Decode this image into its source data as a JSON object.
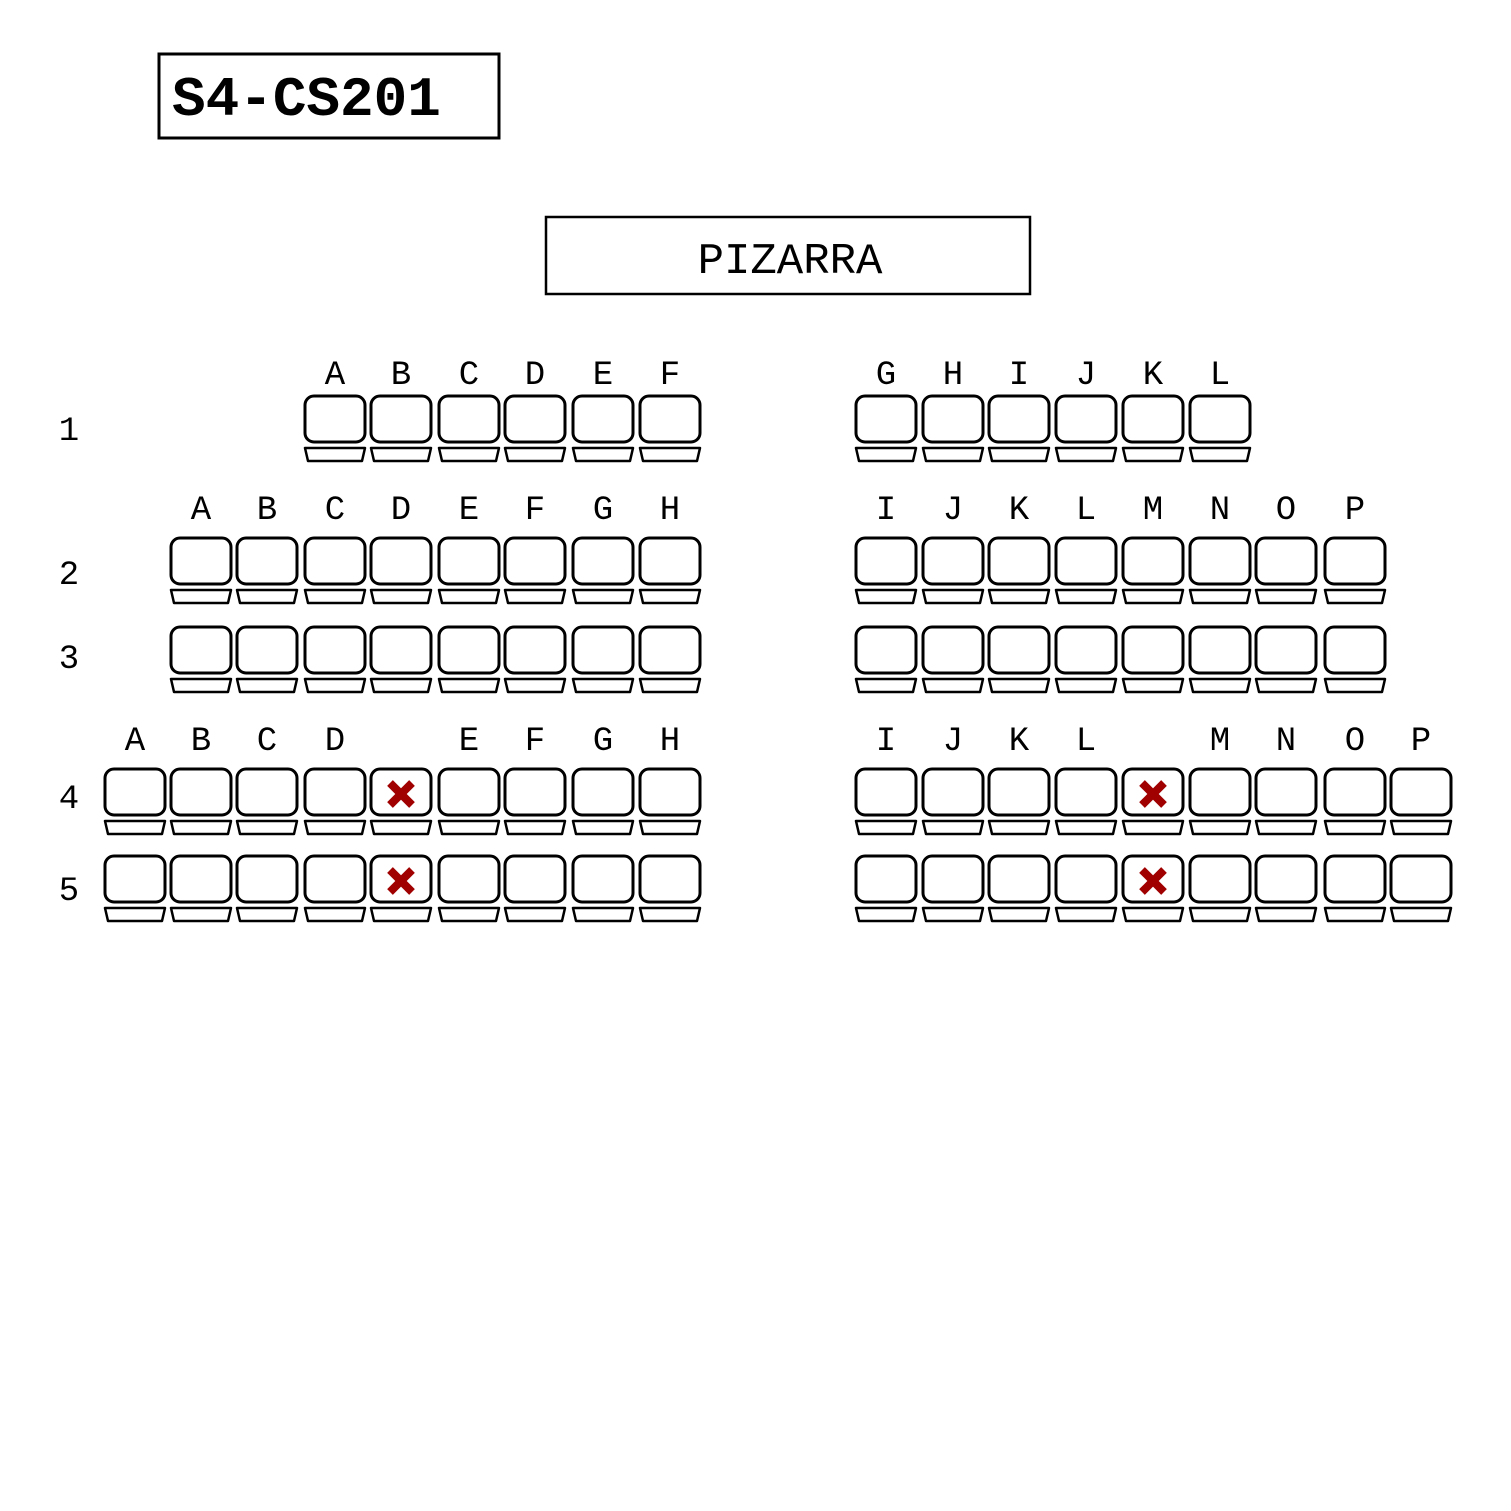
{
  "room_code": "S4-CS201",
  "board_label": "PIZARRA",
  "colors": {
    "unavailable_mark": "#a00000",
    "outline": "#000000"
  },
  "rows": [
    {
      "label": "1",
      "left": {
        "letters": [
          "A",
          "B",
          "C",
          "D",
          "E",
          "F"
        ],
        "unavailable": []
      },
      "right": {
        "letters": [
          "G",
          "H",
          "I",
          "J",
          "K",
          "L"
        ],
        "unavailable": []
      }
    },
    {
      "label": "2",
      "left": {
        "letters": [
          "A",
          "B",
          "C",
          "D",
          "E",
          "F",
          "G",
          "H"
        ],
        "unavailable": []
      },
      "right": {
        "letters": [
          "I",
          "J",
          "K",
          "L",
          "M",
          "N",
          "O",
          "P"
        ],
        "unavailable": []
      }
    },
    {
      "label": "3",
      "left": {
        "letters": [
          "",
          "",
          "",
          "",
          "",
          "",
          "",
          ""
        ],
        "unavailable": []
      },
      "right": {
        "letters": [
          "",
          "",
          "",
          "",
          "",
          "",
          "",
          ""
        ],
        "unavailable": []
      }
    },
    {
      "label": "4",
      "left": {
        "letters": [
          "A",
          "B",
          "C",
          "D",
          "",
          "E",
          "F",
          "G",
          "H"
        ],
        "unavailable": [
          4
        ]
      },
      "right": {
        "letters": [
          "I",
          "J",
          "K",
          "L",
          "",
          "M",
          "N",
          "O",
          "P"
        ],
        "unavailable": [
          4
        ]
      }
    },
    {
      "label": "5",
      "left": {
        "letters": [
          "",
          "",
          "",
          "",
          "",
          "",
          "",
          "",
          ""
        ],
        "unavailable": [
          4
        ]
      },
      "right": {
        "letters": [
          "",
          "",
          "",
          "",
          "",
          "",
          "",
          "",
          ""
        ],
        "unavailable": [
          4
        ]
      }
    }
  ]
}
